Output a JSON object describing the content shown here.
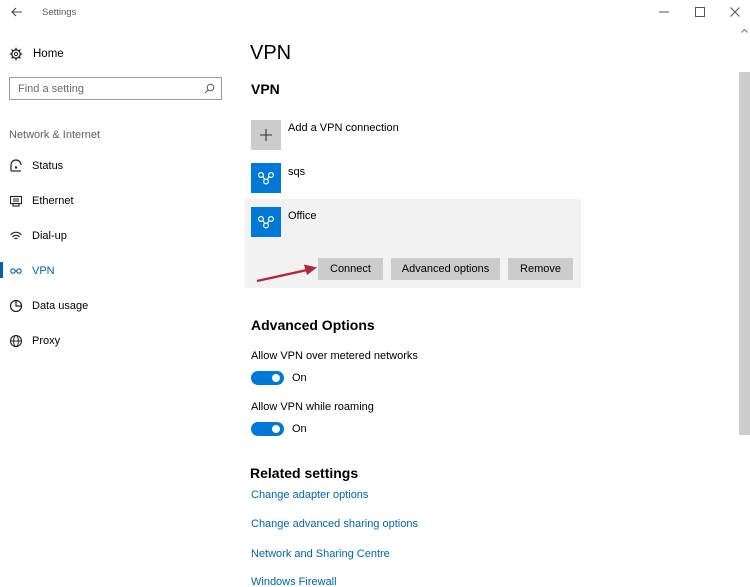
{
  "window": {
    "title": "Settings"
  },
  "sidebar": {
    "home_label": "Home",
    "search_placeholder": "Find a setting",
    "section_label": "Network & Internet",
    "items": [
      {
        "label": "Status",
        "icon": "status-icon"
      },
      {
        "label": "Ethernet",
        "icon": "ethernet-icon"
      },
      {
        "label": "Dial-up",
        "icon": "dialup-icon"
      },
      {
        "label": "VPN",
        "icon": "vpn-icon",
        "active": true
      },
      {
        "label": "Data usage",
        "icon": "data-usage-icon"
      },
      {
        "label": "Proxy",
        "icon": "globe-icon"
      }
    ]
  },
  "main": {
    "page_title": "VPN",
    "vpn_heading": "VPN",
    "add_connection_label": "Add a VPN connection",
    "connections": [
      {
        "name": "sqs"
      },
      {
        "name": "Office",
        "selected": true
      }
    ],
    "buttons": {
      "connect": "Connect",
      "advanced_options": "Advanced options",
      "remove": "Remove"
    },
    "advanced_heading": "Advanced Options",
    "options": [
      {
        "label": "Allow VPN over metered networks",
        "state": "On",
        "enabled": true
      },
      {
        "label": "Allow VPN while roaming",
        "state": "On",
        "enabled": true
      }
    ],
    "related_heading": "Related settings",
    "related_links": [
      "Change adapter options",
      "Change advanced sharing options",
      "Network and Sharing Centre",
      "Windows Firewall"
    ]
  },
  "colors": {
    "accent": "#0078d7",
    "link": "#0063b1",
    "annotation_arrow": "#b3263a"
  }
}
